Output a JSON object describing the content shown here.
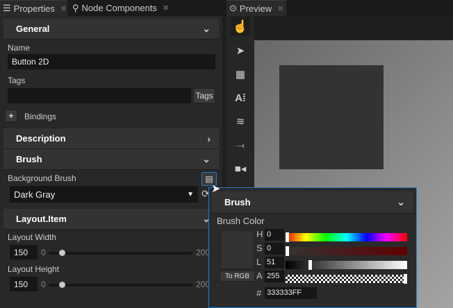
{
  "tabs": {
    "properties": "Properties",
    "node_components": "Node Components",
    "preview": "Preview"
  },
  "sections": {
    "general": "General",
    "description": "Description",
    "brush": "Brush",
    "layout_item": "Layout.Item"
  },
  "fields": {
    "name_label": "Name",
    "name_value": "Button 2D",
    "tags_label": "Tags",
    "tags_button": "Tags",
    "bindings": "Bindings",
    "add_symbol": "+",
    "background_brush_label": "Background Brush",
    "background_brush_value": "Dark Gray"
  },
  "layout": {
    "width_label": "Layout Width",
    "width_value": "150",
    "height_label": "Layout Height",
    "height_value": "150",
    "min": "0",
    "max": "200",
    "width_fraction": 0.09,
    "height_fraction": 0.09
  },
  "popup": {
    "title": "Brush",
    "color_label": "Brush Color",
    "to_rgb": "To RGB",
    "h_label": "H",
    "h": "0",
    "s_label": "S",
    "s": "0",
    "l_label": "L",
    "l": "51",
    "a_label": "A",
    "a": "255",
    "hex_label": "#",
    "hex": "333333FF",
    "swatch_color": "#333333"
  },
  "preview": {
    "square_color": "#333333",
    "tools": [
      "select-node-icon",
      "pointer-icon",
      "table-icon",
      "text-anchor-icon",
      "layers-icon",
      "connect-icon",
      "camera-icon"
    ]
  },
  "colors": {
    "accent": "#1b7fd0"
  }
}
